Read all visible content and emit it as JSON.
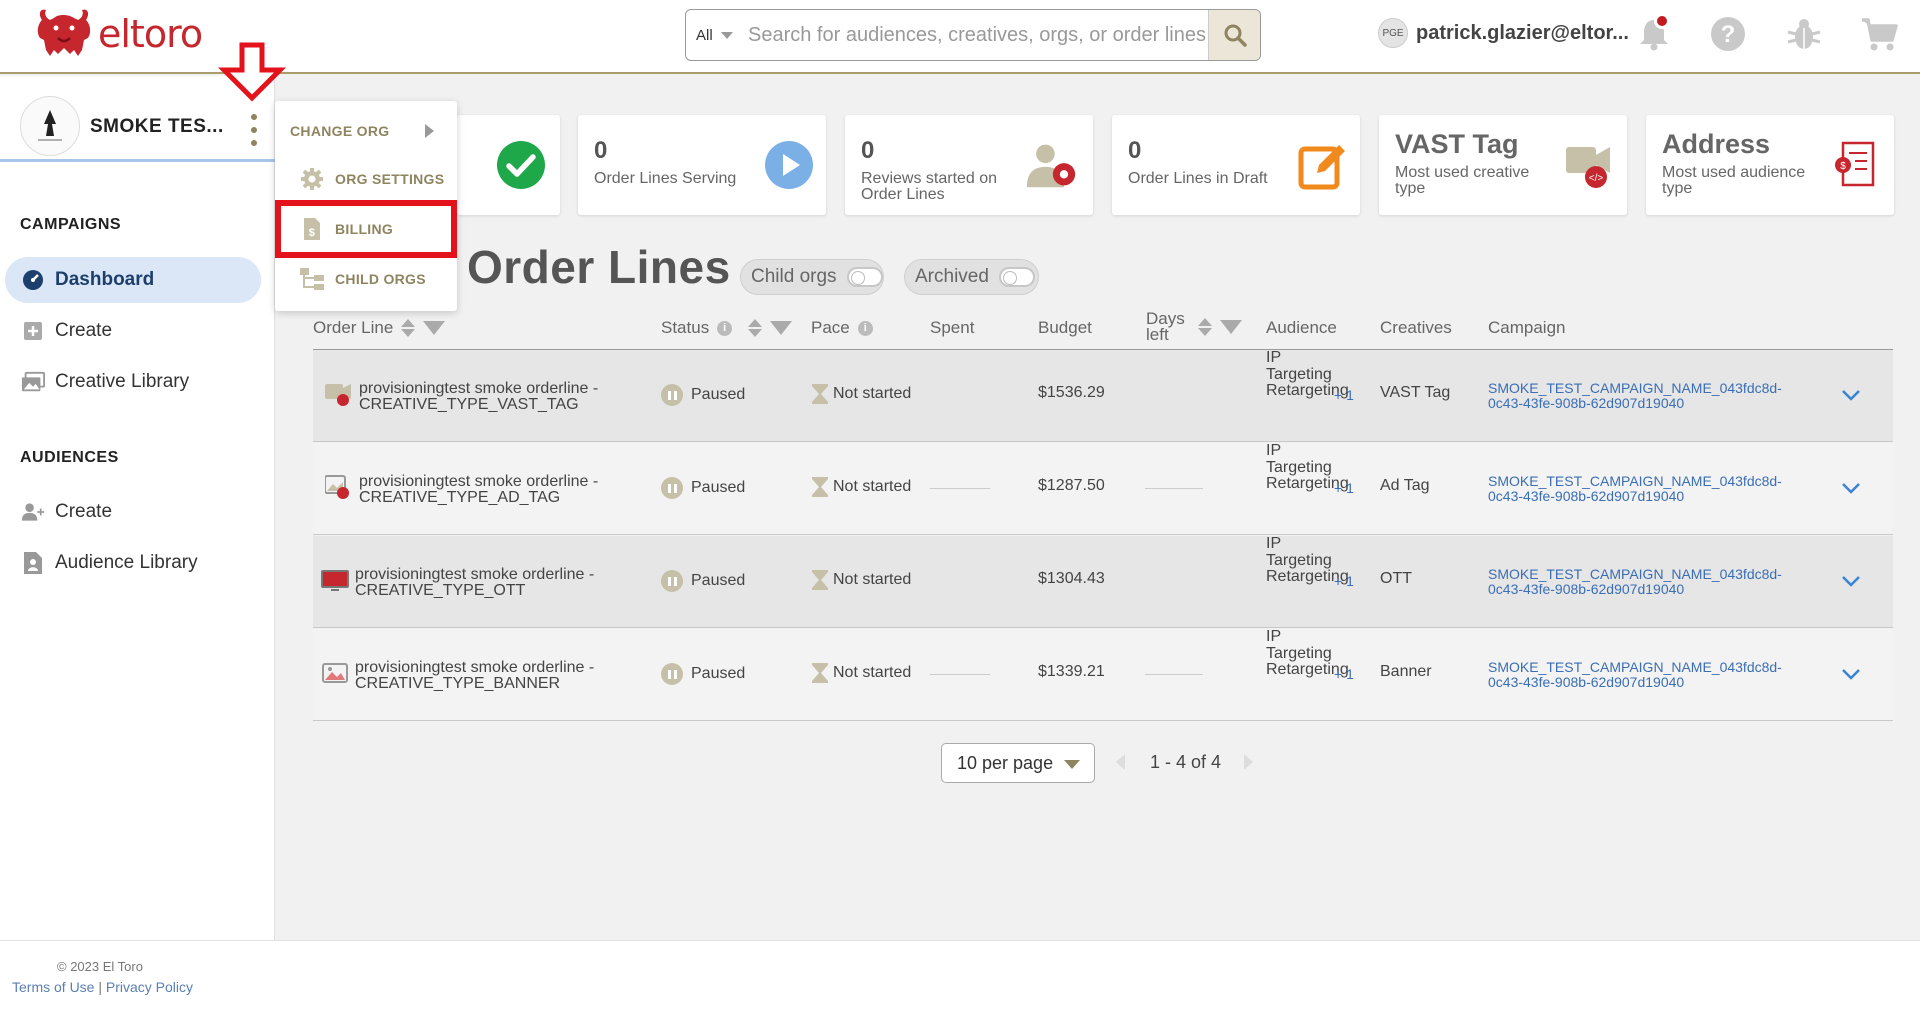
{
  "header": {
    "logo_text": "eltoro",
    "search_scope": "All",
    "search_placeholder": "Search for audiences, creatives, orgs, or order lines",
    "user_initials": "PGE",
    "user_email": "patrick.glazier@eltor..."
  },
  "sidebar": {
    "org_name": "SMOKE TES...",
    "campaigns_title": "CAMPAIGNS",
    "campaign_items": [
      {
        "label": "Dashboard",
        "icon": "dashboard-icon",
        "active": true
      },
      {
        "label": "Create",
        "icon": "plus-square-icon"
      },
      {
        "label": "Creative Library",
        "icon": "images-icon"
      }
    ],
    "audiences_title": "AUDIENCES",
    "audience_items": [
      {
        "label": "Create",
        "icon": "user-plus-icon"
      },
      {
        "label": "Audience Library",
        "icon": "file-person-icon"
      }
    ]
  },
  "org_menu": {
    "items": [
      {
        "label": "CHANGE ORG",
        "icon": "chevron-right-icon"
      },
      {
        "label": "ORG SETTINGS",
        "icon": "gear-icon"
      },
      {
        "label": "BILLING",
        "icon": "invoice-icon"
      },
      {
        "label": "CHILD ORGS",
        "icon": "hierarchy-icon"
      }
    ]
  },
  "stats": {
    "serving": {
      "num": "0",
      "label": "Order Lines Serving"
    },
    "reviews": {
      "num": "0",
      "label": "Reviews started on Order Lines"
    },
    "draft": {
      "num": "0",
      "label": "Order Lines in Draft"
    },
    "creative": {
      "big": "VAST Tag",
      "label": "Most used creative type"
    },
    "audience": {
      "big": "Address",
      "label": "Most used audience type"
    }
  },
  "main": {
    "title": "Order Lines",
    "toggle_child_orgs": "Child orgs",
    "toggle_archived": "Archived"
  },
  "table": {
    "columns": {
      "order_line": "Order Line",
      "status": "Status",
      "pace": "Pace",
      "spent": "Spent",
      "budget": "Budget",
      "days_left": "Days left",
      "audience": "Audience",
      "creatives": "Creatives",
      "campaign": "Campaign"
    },
    "rows": [
      {
        "name": "provisioningtest smoke orderline - CREATIVE_TYPE_VAST_TAG",
        "status": "Paused",
        "pace": "Not started",
        "budget": "$1536.29",
        "audience": "IP Targeting Retargeting",
        "audience_more": "+ 1",
        "creative": "VAST Tag",
        "campaign": "SMOKE_TEST_CAMPAIGN_NAME_043fdc8d-0c43-43fe-908b-62d907d19040"
      },
      {
        "name": "provisioningtest smoke orderline - CREATIVE_TYPE_AD_TAG",
        "status": "Paused",
        "pace": "Not started",
        "budget": "$1287.50",
        "audience": "IP Targeting Retargeting",
        "audience_more": "+ 1",
        "creative": "Ad Tag",
        "campaign": "SMOKE_TEST_CAMPAIGN_NAME_043fdc8d-0c43-43fe-908b-62d907d19040"
      },
      {
        "name": "provisioningtest smoke orderline - CREATIVE_TYPE_OTT",
        "status": "Paused",
        "pace": "Not started",
        "budget": "$1304.43",
        "audience": "IP Targeting Retargeting",
        "audience_more": "+ 1",
        "creative": "OTT",
        "campaign": "SMOKE_TEST_CAMPAIGN_NAME_043fdc8d-0c43-43fe-908b-62d907d19040"
      },
      {
        "name": "provisioningtest smoke orderline - CREATIVE_TYPE_BANNER",
        "status": "Paused",
        "pace": "Not started",
        "budget": "$1339.21",
        "audience": "IP Targeting Retargeting",
        "audience_more": "+ 1",
        "creative": "Banner",
        "campaign": "SMOKE_TEST_CAMPAIGN_NAME_043fdc8d-0c43-43fe-908b-62d907d19040"
      }
    ]
  },
  "pagination": {
    "per_page": "10 per page",
    "range": "1 - 4 of 4"
  },
  "footer": {
    "copyright": "© 2023 El Toro",
    "terms": "Terms of Use",
    "privacy": "Privacy Policy"
  },
  "colors": {
    "brand_red": "#c6262d",
    "accent_gold": "#8f8460",
    "link_blue": "#3a6eb5",
    "highlight_red": "#e3121b"
  }
}
